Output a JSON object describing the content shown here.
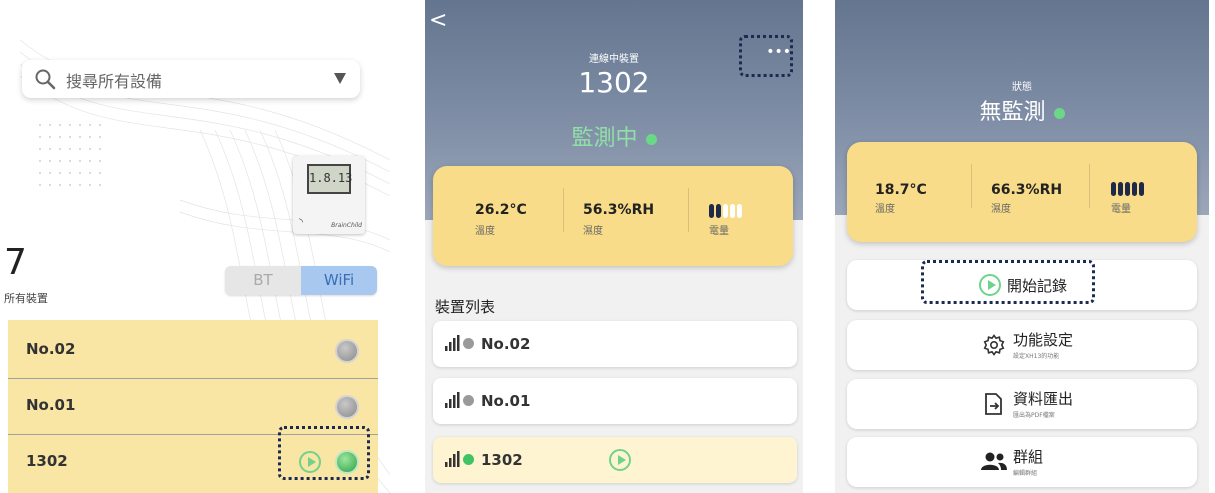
{
  "colors": {
    "accent_green": "#6ad888",
    "card_yellow": "#f8dc8a",
    "header_blue": "#64758f",
    "highlight_dash": "#1b2a52",
    "wifi_tab": "#a8c8f0"
  },
  "panel1": {
    "search": {
      "placeholder": "搜尋所有設備",
      "icon": "search-icon",
      "dropdown_icon": "triangle-down-icon"
    },
    "device_image": {
      "lcd": "1.8.13"
    },
    "device_count": "7",
    "device_count_label": "所有裝置",
    "tabs": {
      "bt": "BT",
      "wifi": "WiFi",
      "selected": "WiFi"
    },
    "devices": [
      {
        "name": "No.02",
        "status": "grey"
      },
      {
        "name": "No.01",
        "status": "grey"
      },
      {
        "name": "1302",
        "status": "green",
        "playing": true
      }
    ]
  },
  "panel2": {
    "back_icon": "chevron-left-icon",
    "subtitle": "連線中裝置",
    "device_name": "1302",
    "more_icon": "ellipsis-icon",
    "status": "監測中",
    "temperature": "26.2°C",
    "temperature_label": "溫度",
    "humidity": "56.3%RH",
    "humidity_label": "濕度",
    "battery_label": "電量",
    "battery_level": 0.4,
    "section_title": "裝置列表",
    "devices": [
      {
        "name": "No.02",
        "status": "grey"
      },
      {
        "name": "No.01",
        "status": "grey"
      },
      {
        "name": "1302",
        "status": "green",
        "selected": true
      }
    ]
  },
  "panel3": {
    "subtitle": "狀態",
    "status": "無監測",
    "temperature": "18.7°C",
    "temperature_label": "溫度",
    "humidity": "66.3%RH",
    "humidity_label": "濕度",
    "battery_label": "電量",
    "battery_level": 1.0,
    "buttons": [
      {
        "label": "開始記錄",
        "icon": "play-circle-icon"
      },
      {
        "label": "功能設定",
        "sub": "設定XH13的功能",
        "icon": "gear-icon"
      },
      {
        "label": "資料匯出",
        "sub": "匯出為PDF檔案",
        "icon": "export-file-icon"
      },
      {
        "label": "群組",
        "sub": "編輯群組",
        "icon": "group-icon"
      }
    ]
  }
}
